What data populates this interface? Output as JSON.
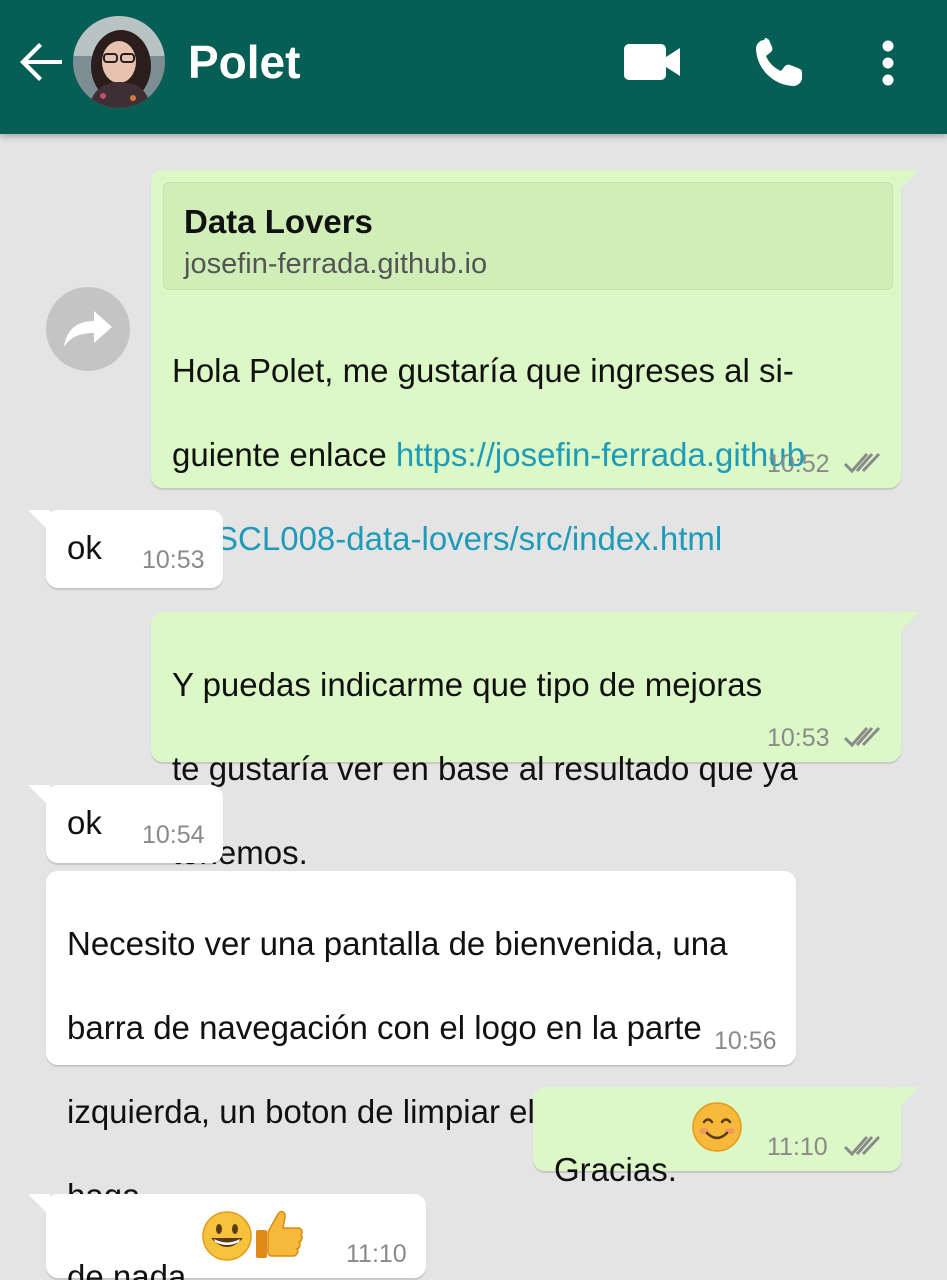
{
  "header": {
    "contact_name": "Polet",
    "back_icon": "arrow-left-icon",
    "video_icon": "video-camera-icon",
    "call_icon": "phone-icon",
    "menu_icon": "more-vertical-icon",
    "color": "#075e54"
  },
  "messages": [
    {
      "direction": "out",
      "link_preview": {
        "title": "Data Lovers",
        "domain": "josefin-ferrada.github.io"
      },
      "text_lines": [
        "Hola Polet, me gustaría que ingreses al si-",
        "guiente enlace "
      ],
      "link_part1": "https://josefin-ferrada.github",
      "link_part2": ".io/SCL008-data-lovers/src/index.html",
      "time": "10:52",
      "status": "read"
    },
    {
      "direction": "in",
      "text": "ok",
      "time": "10:53"
    },
    {
      "direction": "out",
      "text_lines": [
        "Y puedas indicarme que tipo de mejoras",
        "te gustaría ver en base al resultado que ya",
        "tenemos."
      ],
      "time": "10:53",
      "status": "read"
    },
    {
      "direction": "in",
      "text": "ok",
      "time": "10:54"
    },
    {
      "direction": "in",
      "text_lines": [
        "Necesito ver una pantalla de bienvenida, una",
        "barra de navegación con el logo en la parte",
        "izquierda, un boton de limpiar el filtro que",
        "haga."
      ],
      "time": "10:56"
    },
    {
      "direction": "out",
      "text": "Gracias.",
      "emoji": "smiling-face-icon",
      "time": "11:10",
      "status": "read"
    },
    {
      "direction": "in",
      "text": "de nada",
      "emoji": [
        "grinning-face-icon",
        "thumbs-up-icon"
      ],
      "time": "11:10"
    }
  ],
  "colors": {
    "outgoing_bubble": "#dcf8c6",
    "incoming_bubble": "#ffffff",
    "link": "#1e9bb8",
    "read_ticks": "#8a8a8a",
    "chat_background": "#e4e4e4"
  }
}
